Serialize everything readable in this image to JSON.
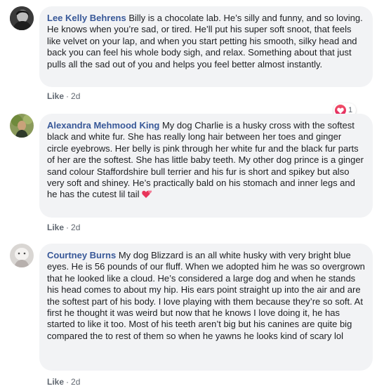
{
  "comments": [
    {
      "author": "Lee Kelly Behrens",
      "text": "Billy is a chocolate lab. He’s silly and funny, and so loving. He knows when you’re sad, or tired. He’ll put his super soft snoot, that feels like velvet on your lap, and when you start petting his smooth, silky head and back you can feel his whole body sigh, and relax. Something about that just pulls all the sad out of you and helps you feel better almost instantly.",
      "like_label": "Like",
      "time": "2d",
      "reaction_count": "1",
      "reaction_icon": "heart-icon"
    },
    {
      "author": "Alexandra Mehmood King",
      "text": "My dog Charlie is a husky cross with the softest black and white fur. She has really long hair between her toes and ginger circle eyebrows. Her belly is pink through her white fur and the black fur parts of her are the softest. She has little baby teeth. My other dog prince is a ginger sand colour Staffordshire bull terrier and his fur is short and spikey but also very soft and shiney. He’s practically bald on his stomach and inner legs and he has the cutest lil tail",
      "emoji": "two-hearts-icon",
      "like_label": "Like",
      "time": "2d"
    },
    {
      "author": "Courtney Burns",
      "text": "My dog Blizzard is an all white husky with very bright blue eyes. He is 56 pounds of our fluff. When we adopted him he was so overgrown that he looked like a cloud. He’s considered a large dog and when he stands his head comes to about my hip. His ears point straight up into the air and are the softest part of his body. I love playing with them because they’re so soft. At first he thought it was weird but now that he knows I love doing it, he has started to like it too. Most of his teeth aren’t big but his canines are quite big compared the to rest of them so when he yawns he looks kind of scary lol",
      "like_label": "Like",
      "time": "2d"
    }
  ],
  "separator": "·"
}
